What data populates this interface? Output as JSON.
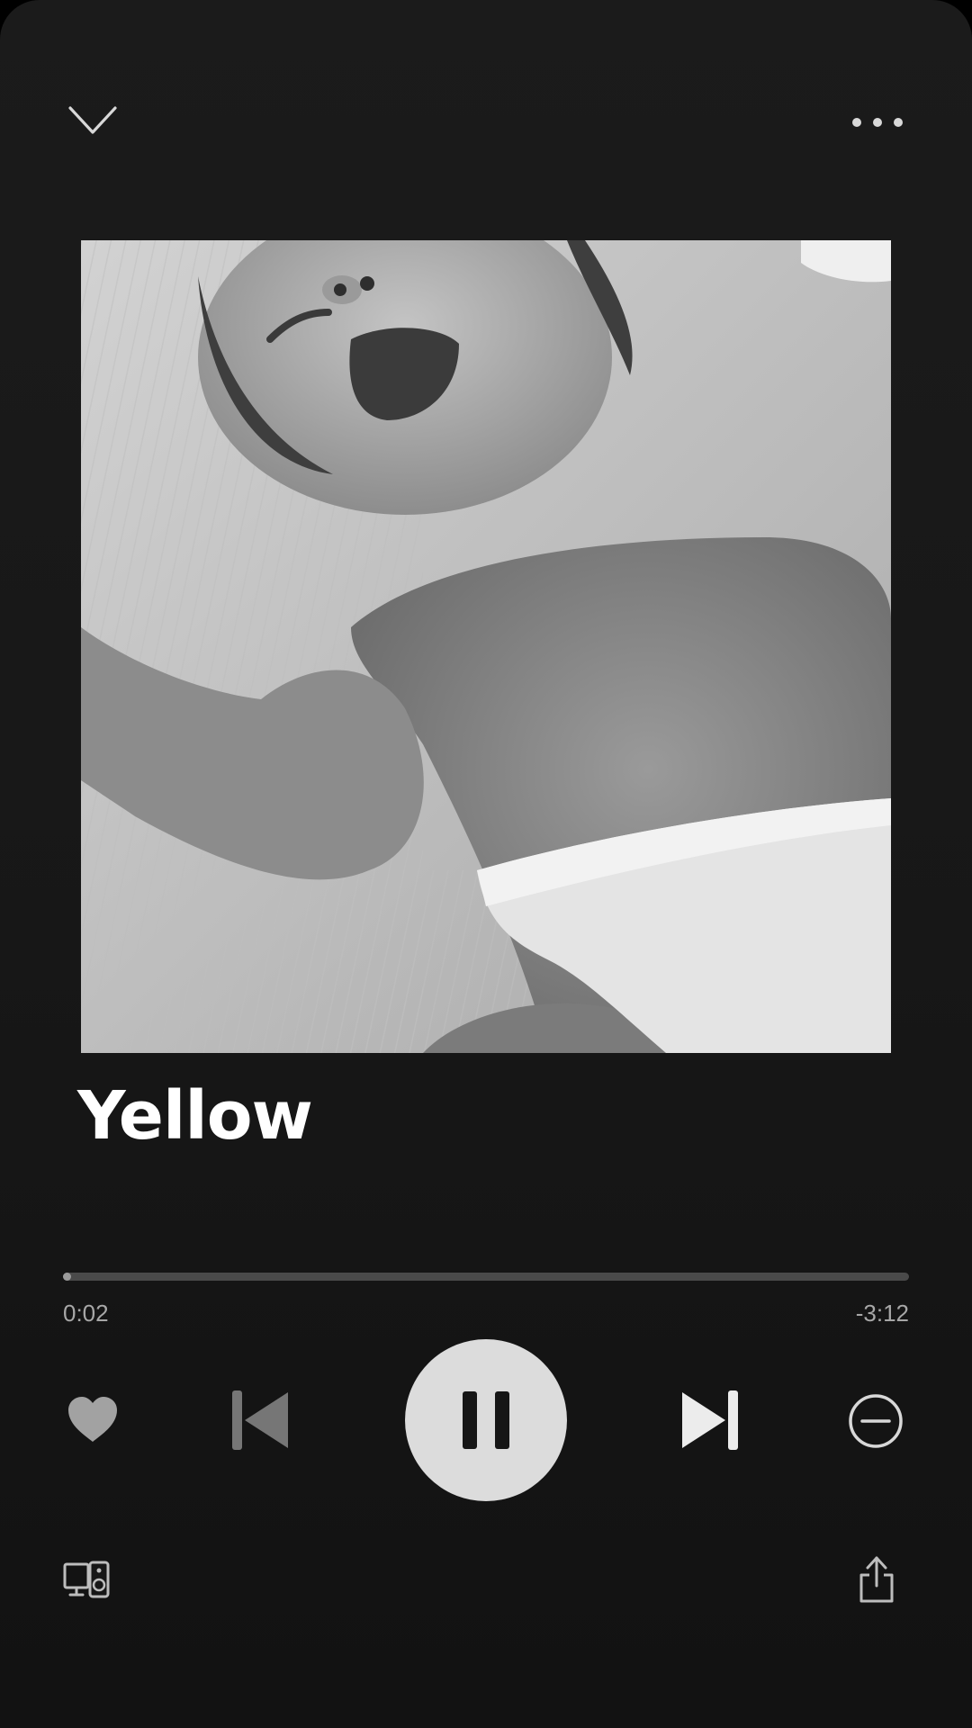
{
  "track": {
    "title": "Yellow"
  },
  "playback": {
    "elapsed": "0:02",
    "remaining": "-3:12",
    "progress_fraction": 0.01,
    "state": "playing"
  },
  "icons": {
    "collapse": "chevron-down-icon",
    "more": "more-options-icon",
    "like": "heart-icon",
    "previous": "skip-previous-icon",
    "pause": "pause-icon",
    "next": "skip-next-icon",
    "remove": "minus-circle-icon",
    "devices": "connect-devices-icon",
    "share": "share-icon"
  },
  "colors": {
    "background": "#171717",
    "text": "#ffffff",
    "muted_text": "#a7a7a7",
    "play_button": "#dcdcdc",
    "track": "#4a4a4a"
  }
}
